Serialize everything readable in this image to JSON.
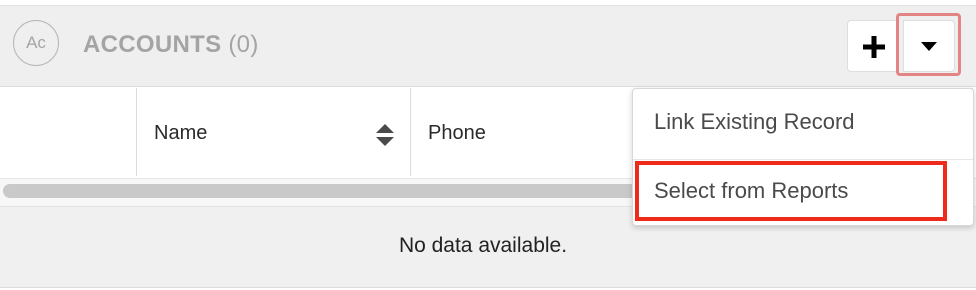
{
  "subpanel": {
    "module_icon_text": "Ac",
    "title": "ACCOUNTS",
    "count": "(0)",
    "add_button_icon": "plus-icon",
    "actions_button_icon": "caret-down-icon"
  },
  "table": {
    "columns": [
      {
        "label": ""
      },
      {
        "label": "Name",
        "sortable": true
      },
      {
        "label": "Phone"
      }
    ],
    "empty_message": "No data available."
  },
  "actions_menu": {
    "items": [
      {
        "label": "Link Existing Record",
        "highlighted": false
      },
      {
        "label": "Select from Reports",
        "highlighted": true
      }
    ]
  },
  "colors": {
    "highlight_red": "#ee2b1b",
    "highlight_soft": "#e48585",
    "header_bg": "#efefef"
  }
}
